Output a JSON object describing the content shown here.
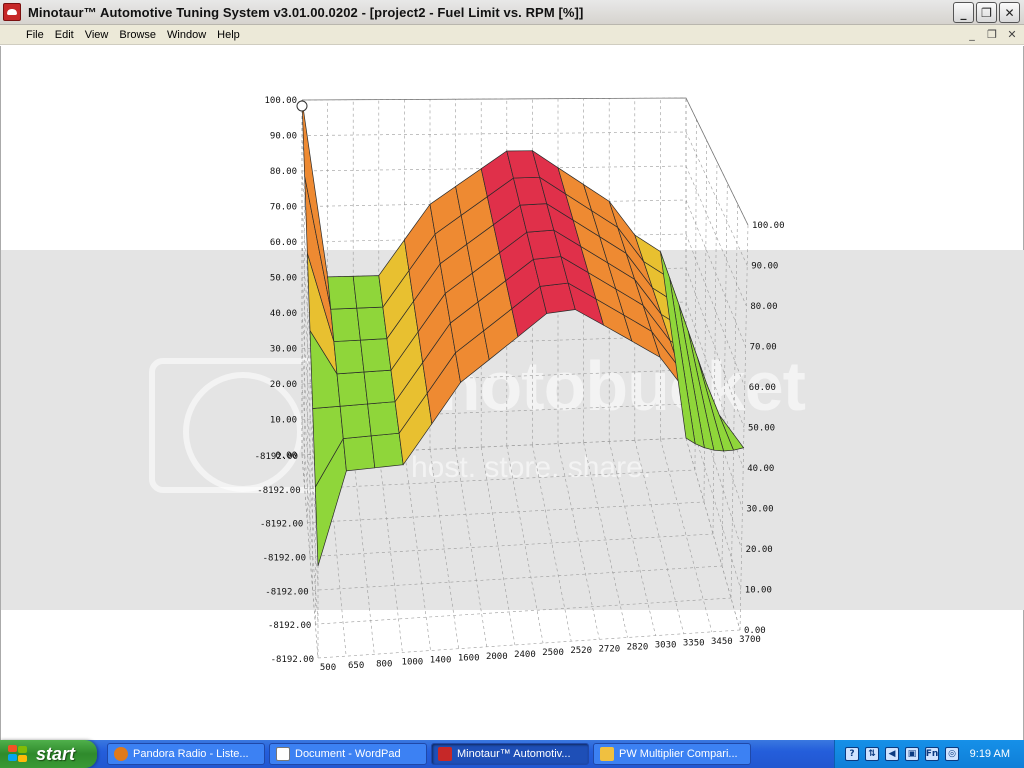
{
  "window": {
    "title": "Minotaur™ Automotive Tuning System  v3.01.00.0202 - [project2 - Fuel Limit vs. RPM [%]]",
    "controls": [
      "_",
      "❐",
      "✕"
    ],
    "mdi_controls": [
      "_",
      "❐",
      "✕"
    ]
  },
  "menu": [
    "File",
    "Edit",
    "View",
    "Browse",
    "Window",
    "Help"
  ],
  "watermark": {
    "main": "photobucket",
    "sub": "host. store. share."
  },
  "chart_data": {
    "type": "surface-3d",
    "title": "Fuel Limit vs. RPM [%]",
    "x_axis": {
      "label": "RPM",
      "ticks": [
        "500",
        "650",
        "800",
        "1000",
        "1400",
        "1600",
        "2000",
        "2400",
        "2500",
        "2520",
        "2720",
        "2820",
        "3030",
        "3350",
        "3450",
        "3700"
      ]
    },
    "z_axis_left": {
      "ticks": [
        "0.00",
        "10.00",
        "20.00",
        "30.00",
        "40.00",
        "50.00",
        "60.00",
        "70.00",
        "80.00",
        "90.00",
        "100.00"
      ],
      "range": [
        0,
        100
      ]
    },
    "y_axis_left": {
      "ticks": [
        "-8192.00",
        "-8192.00",
        "-8192.00",
        "-8192.00",
        "-8192.00",
        "-8192.00",
        "-8192.00"
      ]
    },
    "z_axis_right": {
      "ticks": [
        "0.00",
        "10.00",
        "20.00",
        "30.00",
        "40.00",
        "50.00",
        "60.00",
        "70.00",
        "80.00",
        "90.00",
        "100.00"
      ]
    },
    "rpm": [
      500,
      650,
      800,
      1000,
      1400,
      1600,
      2000,
      2400,
      2500,
      2520,
      2720,
      2820,
      3030,
      3350,
      3450,
      3700
    ],
    "fuel_limit_pct": [
      100,
      50,
      50,
      50,
      60,
      70,
      75,
      80,
      85,
      85,
      80,
      75,
      70,
      60,
      55,
      0
    ],
    "colors": {
      "low": "#2e7bd6",
      "mid_low": "#8fd63a",
      "mid": "#e8c030",
      "mid_high": "#ee8a32",
      "high": "#e0304a"
    }
  },
  "taskbar": {
    "start_label": "start",
    "tasks": [
      {
        "label": "Pandora Radio - Liste...",
        "icon_color": "#e07a1c",
        "active": false
      },
      {
        "label": "Document - WordPad",
        "icon_color": "#ffffff",
        "active": false
      },
      {
        "label": "Minotaur™ Automotiv...",
        "icon_color": "#c62828",
        "active": true
      },
      {
        "label": "PW Multiplier Compari...",
        "icon_color": "#f0c040",
        "active": false
      }
    ],
    "tray_icons": [
      "?",
      "⇅",
      "◀",
      "▣",
      "Fn",
      "◎"
    ],
    "clock": "9:19 AM"
  }
}
